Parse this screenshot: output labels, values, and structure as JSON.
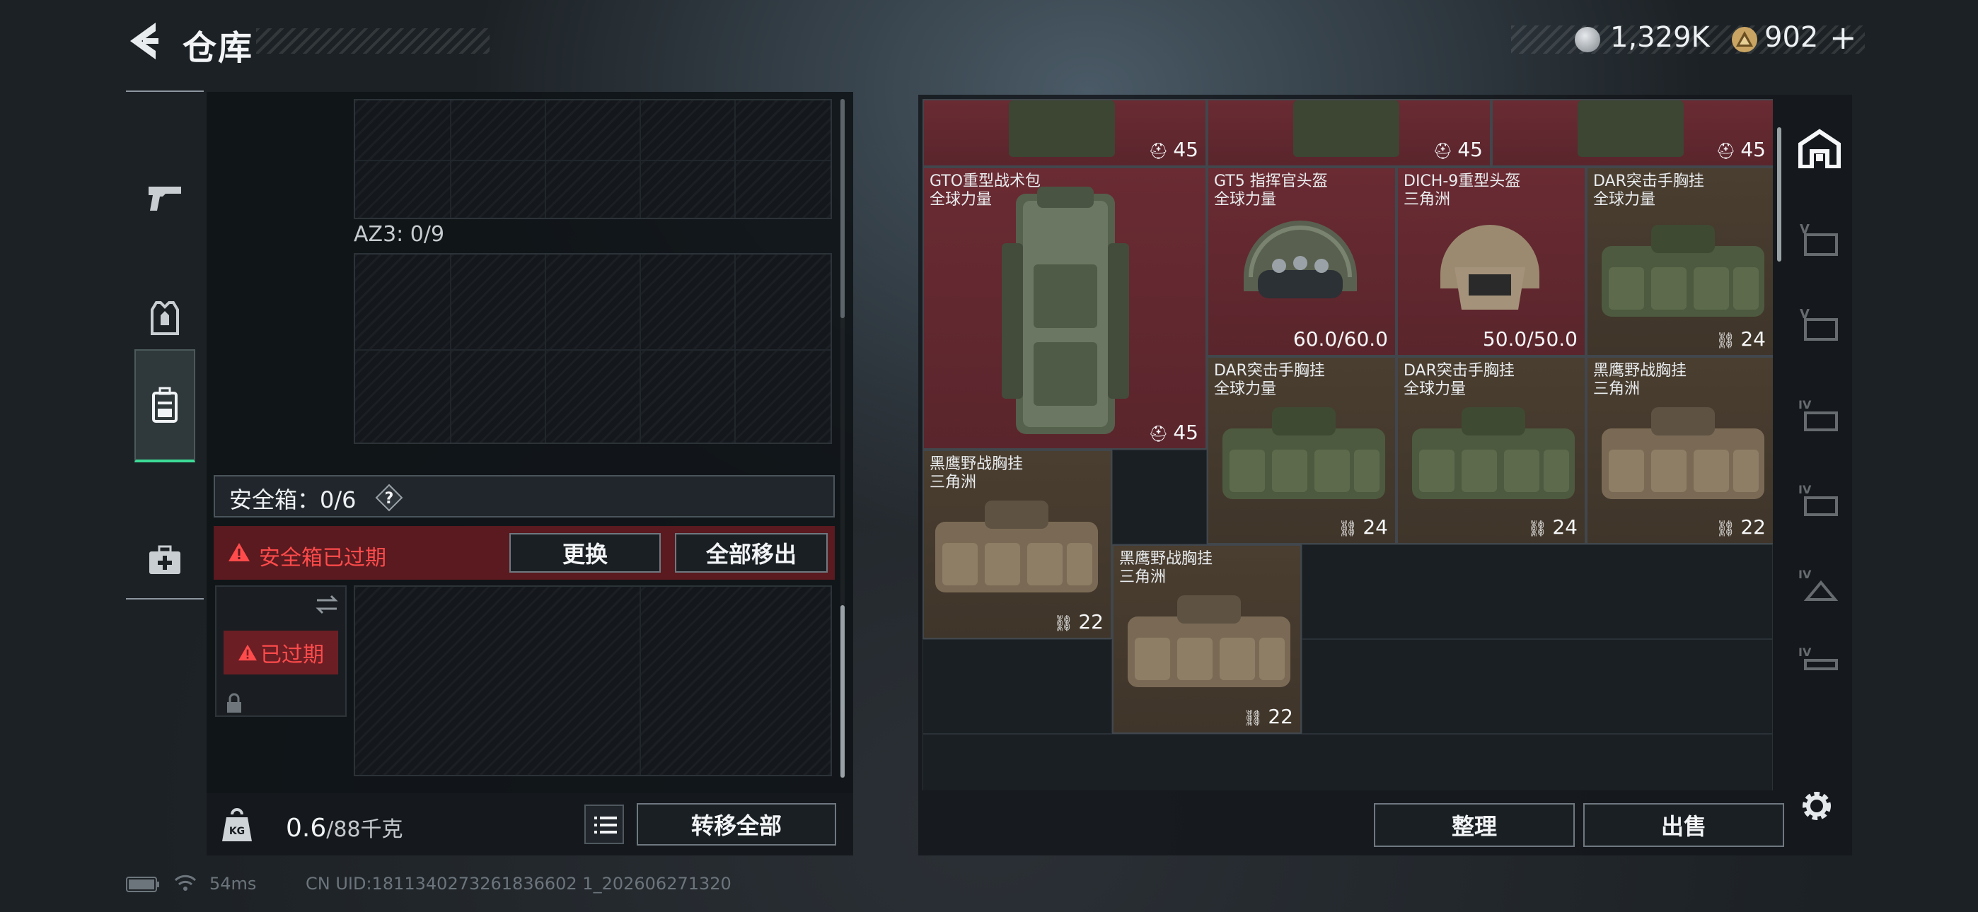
{
  "header": {
    "title": "仓库",
    "currency": [
      {
        "icon": "silver-coin-icon",
        "value": "1,329K"
      },
      {
        "icon": "gold-triangle-coin-icon",
        "value": "902"
      }
    ],
    "add_symbol": "+"
  },
  "left_tabs": [
    {
      "icon": "pistol-icon",
      "active": false
    },
    {
      "icon": "armor-vest-icon",
      "active": false
    },
    {
      "icon": "backpack-icon",
      "active": true
    },
    {
      "icon": "medkit-icon",
      "active": false
    }
  ],
  "container": {
    "az3_label": "AZ3: 0/9",
    "safebox_label": "安全箱：0/6",
    "help_symbol": "?",
    "expired_warning": "安全箱已过期",
    "replace_button": "更换",
    "move_all_out_button": "全部移出",
    "expired_badge": "已过期"
  },
  "bottom_left": {
    "weight_value": "0.6",
    "weight_capacity": "/88千克",
    "transfer_all_button": "转移全部"
  },
  "stash_items": [
    {
      "name": "",
      "source": "",
      "value": "45",
      "value_icon": "weight-icon",
      "tone": "red"
    },
    {
      "name": "",
      "source": "",
      "value": "45",
      "value_icon": "weight-icon",
      "tone": "red"
    },
    {
      "name": "",
      "source": "",
      "value": "45",
      "value_icon": "weight-icon",
      "tone": "red"
    },
    {
      "name": "GTO重型战术包",
      "source": "全球力量",
      "value": "45",
      "value_icon": "weight-icon",
      "tone": "red"
    },
    {
      "name": "GT5 指挥官头盔",
      "source": "全球力量",
      "value": "60.0/60.0",
      "value_icon": "",
      "tone": "red"
    },
    {
      "name": "DICH-9重型头盔",
      "source": "三角洲",
      "value": "50.0/50.0",
      "value_icon": "",
      "tone": "red"
    },
    {
      "name": "DAR突击手胸挂",
      "source": "全球力量",
      "value": "24",
      "value_icon": "chest-rig-icon",
      "tone": "brown"
    },
    {
      "name": "DAR突击手胸挂",
      "source": "全球力量",
      "value": "24",
      "value_icon": "chest-rig-icon",
      "tone": "brown"
    },
    {
      "name": "DAR突击手胸挂",
      "source": "全球力量",
      "value": "24",
      "value_icon": "chest-rig-icon",
      "tone": "brown"
    },
    {
      "name": "黑鹰野战胸挂",
      "source": "三角洲",
      "value": "22",
      "value_icon": "chest-rig-icon",
      "tone": "brown"
    },
    {
      "name": "黑鹰野战胸挂",
      "source": "三角洲",
      "value": "22",
      "value_icon": "chest-rig-icon",
      "tone": "brown"
    },
    {
      "name": "黑鹰野战胸挂",
      "source": "三角洲",
      "value": "22",
      "value_icon": "chest-rig-icon",
      "tone": "brown"
    }
  ],
  "stash_actions": {
    "sort_button": "整理",
    "sell_button": "出售"
  },
  "right_tabs": [
    {
      "icon": "stash-home-icon",
      "active": true
    },
    {
      "icon": "stash-page-v-icon",
      "label": "V",
      "active": false
    },
    {
      "icon": "stash-page-v-icon",
      "label": "V",
      "active": false
    },
    {
      "icon": "stash-page-iv-icon",
      "label": "IV",
      "active": false
    },
    {
      "icon": "stash-page-iv-icon",
      "label": "IV",
      "active": false
    },
    {
      "icon": "stash-page-iv-icon",
      "label": "IV",
      "active": false
    },
    {
      "icon": "stash-page-iv-icon",
      "label": "IV",
      "active": false
    }
  ],
  "status": {
    "ping": "54ms",
    "uid": "CN UID:1811340273261836602 1_202606271320"
  }
}
